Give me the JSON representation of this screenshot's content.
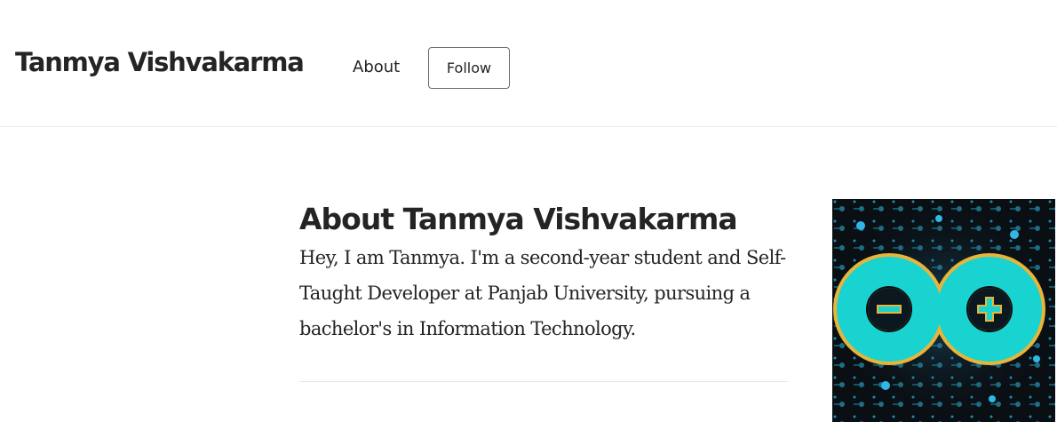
{
  "header": {
    "brand": "Tanmya Vishvakarma",
    "nav_about": "About",
    "follow_label": "Follow"
  },
  "about": {
    "title": "About Tanmya Vishvakarma",
    "bio": "Hey, I am Tanmya. I'm a second-year student and Self-Taught Developer at Panjab University, pursuing a bachelor's in Information Technology."
  },
  "avatar": {
    "icon": "arduino-logo-icon",
    "colors": {
      "accent": "#19d3d0",
      "outline": "#e8b43a",
      "background": "#0a0f14"
    }
  }
}
